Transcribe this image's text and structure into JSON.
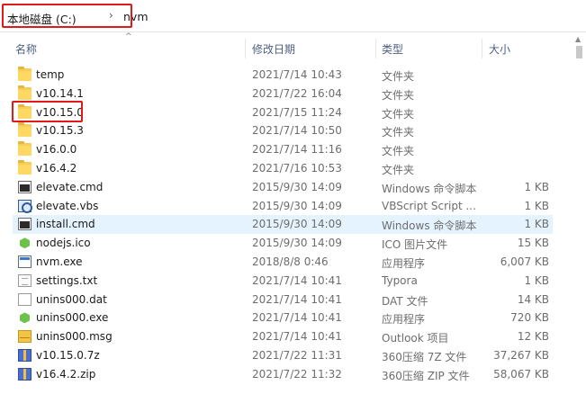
{
  "breadcrumb": {
    "drive": "本地磁盘 (C:)",
    "separator": "›",
    "folder": "nvm"
  },
  "columns": {
    "name": "名称",
    "date": "修改日期",
    "type": "类型",
    "size": "大小"
  },
  "files": [
    {
      "name": "temp",
      "date": "2021/7/14 10:43",
      "type": "文件夹",
      "size": "",
      "icon": "folder-icon"
    },
    {
      "name": "v10.14.1",
      "date": "2021/7/22 16:04",
      "type": "文件夹",
      "size": "",
      "icon": "folder-icon"
    },
    {
      "name": "v10.15.0",
      "date": "2021/7/15 11:24",
      "type": "文件夹",
      "size": "",
      "icon": "folder-icon"
    },
    {
      "name": "v10.15.3",
      "date": "2021/7/14 10:50",
      "type": "文件夹",
      "size": "",
      "icon": "folder-icon"
    },
    {
      "name": "v16.0.0",
      "date": "2021/7/14 11:16",
      "type": "文件夹",
      "size": "",
      "icon": "folder-icon"
    },
    {
      "name": "v16.4.2",
      "date": "2021/7/16 10:53",
      "type": "文件夹",
      "size": "",
      "icon": "folder-icon"
    },
    {
      "name": "elevate.cmd",
      "date": "2015/9/30 14:09",
      "type": "Windows 命令脚本",
      "size": "1 KB",
      "icon": "cmd-file-icon"
    },
    {
      "name": "elevate.vbs",
      "date": "2015/9/30 14:09",
      "type": "VBScript Script ...",
      "size": "1 KB",
      "icon": "vbs-file-icon"
    },
    {
      "name": "install.cmd",
      "date": "2015/9/30 14:09",
      "type": "Windows 命令脚本",
      "size": "1 KB",
      "icon": "cmd-file-icon"
    },
    {
      "name": "nodejs.ico",
      "date": "2015/9/30 14:09",
      "type": "ICO 图片文件",
      "size": "15 KB",
      "icon": "nodejs-icon"
    },
    {
      "name": "nvm.exe",
      "date": "2018/8/8 0:46",
      "type": "应用程序",
      "size": "6,007 KB",
      "icon": "exe-file-icon"
    },
    {
      "name": "settings.txt",
      "date": "2021/7/14 10:41",
      "type": "Typora",
      "size": "1 KB",
      "icon": "txt-file-icon"
    },
    {
      "name": "unins000.dat",
      "date": "2021/7/14 10:41",
      "type": "DAT 文件",
      "size": "14 KB",
      "icon": "dat-file-icon"
    },
    {
      "name": "unins000.exe",
      "date": "2021/7/14 10:41",
      "type": "应用程序",
      "size": "720 KB",
      "icon": "nodejs-icon"
    },
    {
      "name": "unins000.msg",
      "date": "2021/7/14 10:41",
      "type": "Outlook 项目",
      "size": "12 KB",
      "icon": "msg-file-icon"
    },
    {
      "name": "v10.15.0.7z",
      "date": "2021/7/22 11:31",
      "type": "360压缩 7Z 文件",
      "size": "37,267 KB",
      "icon": "archive-icon"
    },
    {
      "name": "v16.4.2.zip",
      "date": "2021/7/22 11:32",
      "type": "360压缩 ZIP 文件",
      "size": "58,067 KB",
      "icon": "archive-icon"
    }
  ],
  "selected_row": "install.cmd",
  "highlight_color": "#e01919",
  "selection_color": "#e5f3ff"
}
